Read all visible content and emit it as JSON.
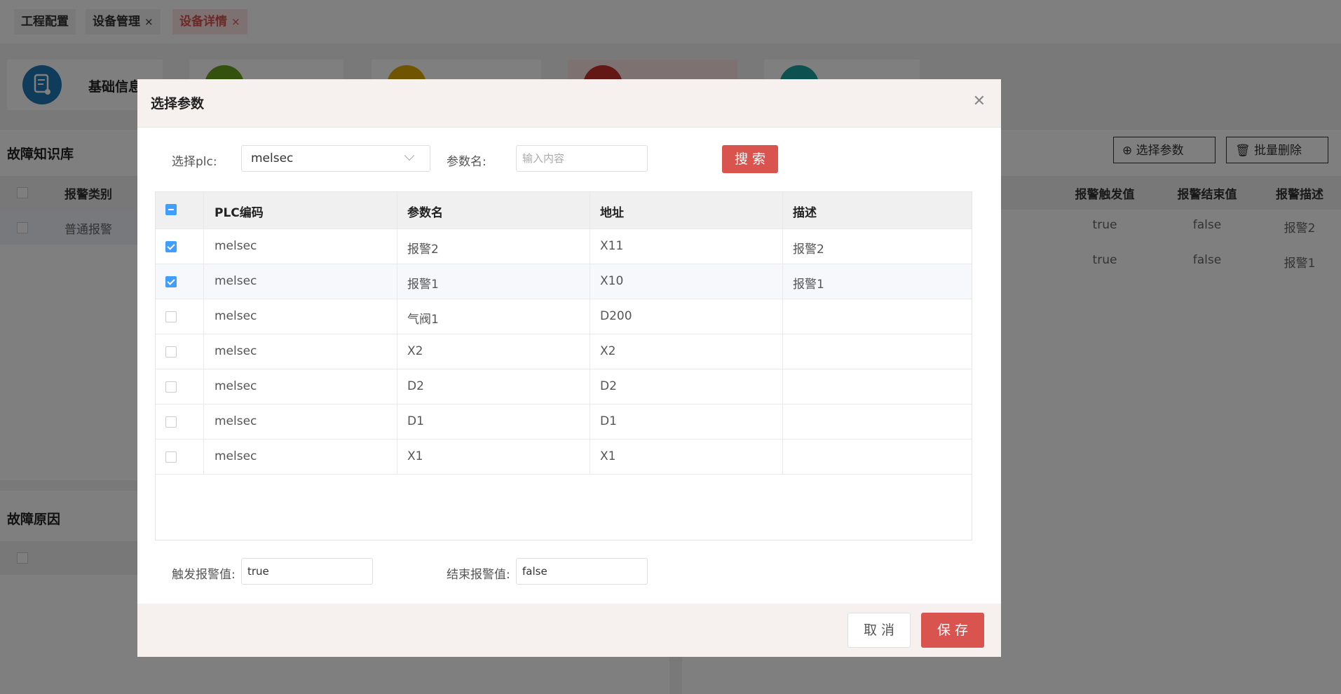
{
  "tabs": [
    {
      "label": "工程配置"
    },
    {
      "label": "设备管理",
      "close": "×"
    },
    {
      "label": "设备详情",
      "close": "×"
    }
  ],
  "cards": [
    {
      "title": "基础信息",
      "color": "#1e78b5"
    }
  ],
  "background": {
    "left_title": "故障知识库",
    "left_col1": "报警类别",
    "left_row1": "普通报警",
    "left2_title": "故障原因",
    "select_param_btn": "选择参数",
    "batch_delete_btn": "批量删除",
    "right_cols": [
      "报警触发值",
      "报警结束值",
      "报警描述"
    ],
    "right_rows": [
      [
        "true",
        "false",
        "报警2"
      ],
      [
        "true",
        "false",
        "报警1"
      ]
    ]
  },
  "modal": {
    "title": "选择参数",
    "plc_label": "选择plc:",
    "plc_value": "melsec",
    "param_label": "参数名:",
    "param_placeholder": "输入内容",
    "search_btn": "搜 索",
    "columns": [
      "PLC编码",
      "参数名",
      "地址",
      "描述"
    ],
    "rows": [
      {
        "checked": true,
        "plc": "melsec",
        "name": "报警2",
        "addr": "X11",
        "desc": "报警2"
      },
      {
        "checked": true,
        "plc": "melsec",
        "name": "报警1",
        "addr": "X10",
        "desc": "报警1"
      },
      {
        "checked": false,
        "plc": "melsec",
        "name": "气阀1",
        "addr": "D200",
        "desc": ""
      },
      {
        "checked": false,
        "plc": "melsec",
        "name": "X2",
        "addr": "X2",
        "desc": ""
      },
      {
        "checked": false,
        "plc": "melsec",
        "name": "D2",
        "addr": "D2",
        "desc": ""
      },
      {
        "checked": false,
        "plc": "melsec",
        "name": "D1",
        "addr": "D1",
        "desc": ""
      },
      {
        "checked": false,
        "plc": "melsec",
        "name": "X1",
        "addr": "X1",
        "desc": ""
      }
    ],
    "trigger_label": "触发报警值:",
    "trigger_value": "true",
    "end_label": "结束报警值:",
    "end_value": "false",
    "cancel_btn": "取 消",
    "save_btn": "保 存"
  },
  "colors": {
    "accent": "#d9534f",
    "checkbox": "#409eff"
  }
}
